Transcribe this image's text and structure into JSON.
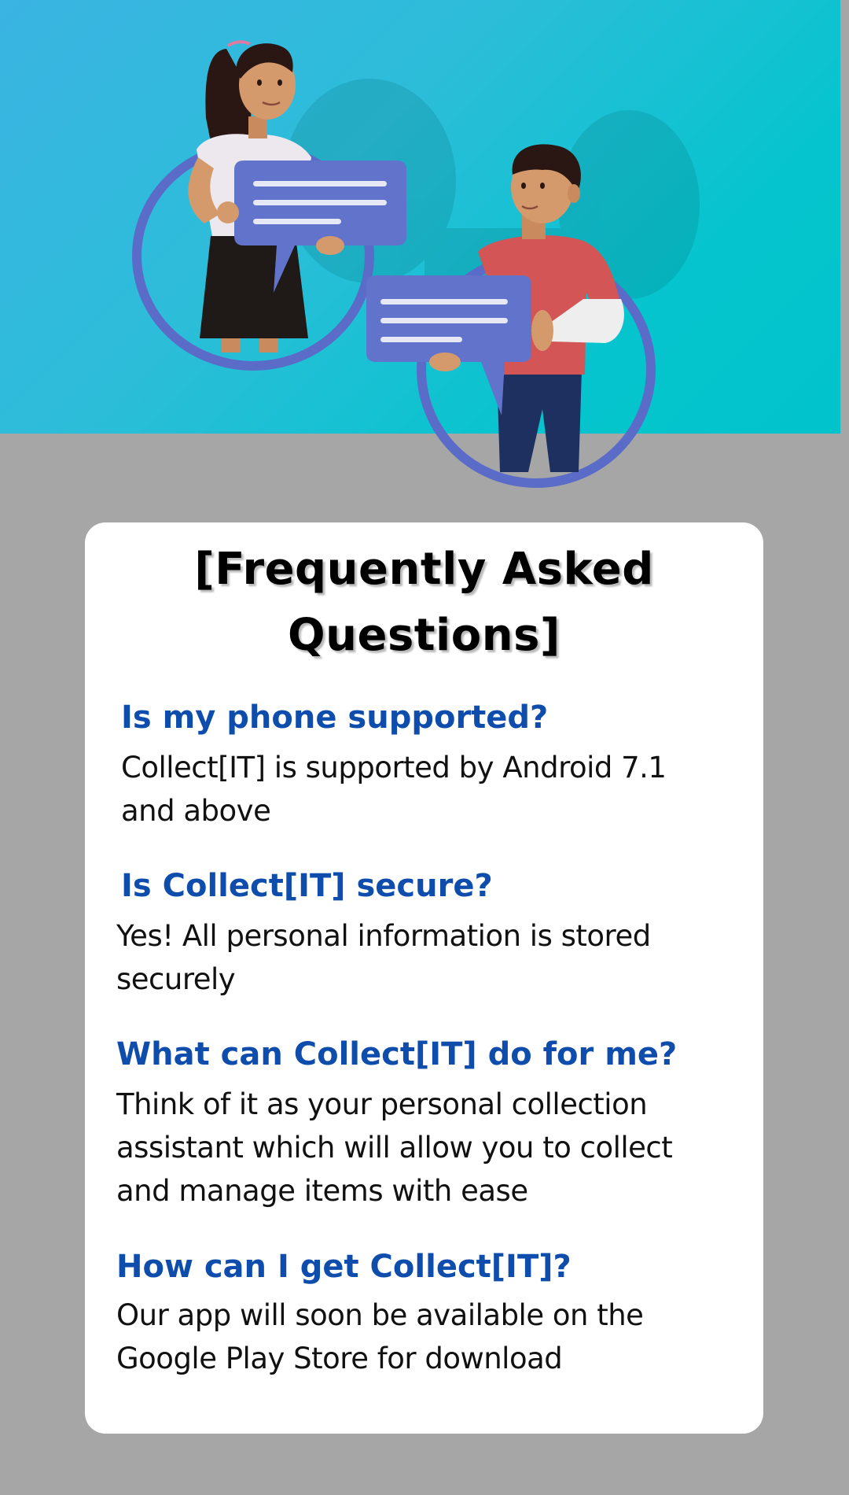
{
  "hero": {
    "illustration_icon": "two-people-with-chat-bubbles-illustration"
  },
  "faq": {
    "title": "[Frequently Asked Questions]",
    "items": [
      {
        "question": "Is my phone supported?",
        "answer": "Collect[IT] is supported by Android 7.1 and above"
      },
      {
        "question": "Is Collect[IT] secure?",
        "answer": "Yes! All personal information is stored securely"
      },
      {
        "question": "What can Collect[IT] do for me?",
        "answer": "Think of it as your personal collection assistant which will allow you to collect and manage items with ease"
      },
      {
        "question": "How can I get Collect[IT]?",
        "answer": "Our app will soon be available on the Google Play Store for download"
      }
    ]
  },
  "colors": {
    "background": "#a6a6a6",
    "hero_teal": "#00c3cb",
    "question_blue": "#0f4dad",
    "card": "#ffffff"
  }
}
